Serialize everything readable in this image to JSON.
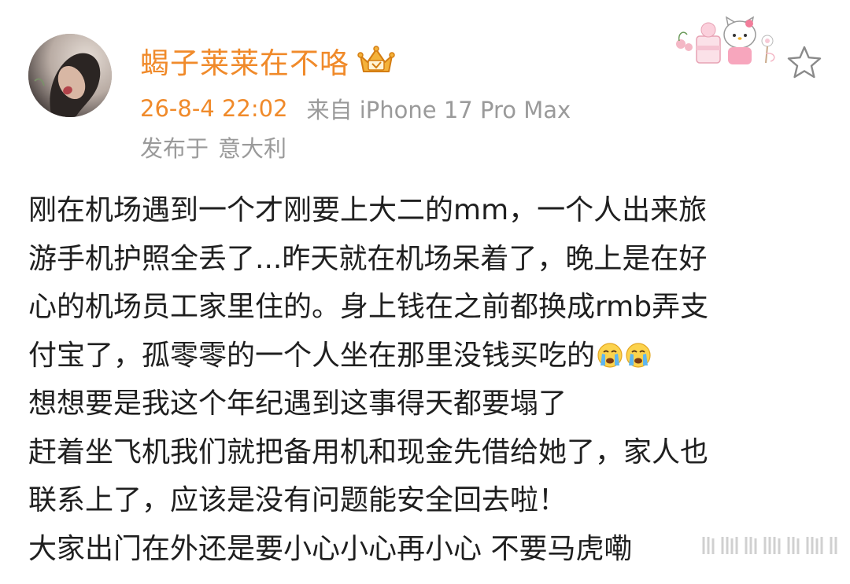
{
  "header": {
    "username": "蝎子莱莱在不咯",
    "timestamp": "26-8-4 22:02",
    "source": "来自 iPhone 17 Pro Max",
    "location_prefix": "发布于",
    "location": "意大利"
  },
  "icons": {
    "vip": "crown-vip-icon",
    "star": "star-icon",
    "decoration": "hello-kitty-sticker",
    "emoji": "crying-face-icon"
  },
  "post": {
    "lines": [
      "刚在机场遇到一个才刚要上大二的mm，一个人出来旅",
      "游手机护照全丢了...昨天就在机场呆着了，晚上是在好",
      "心的机场员工家里住的。身上钱在之前都换成rmb弄支",
      "付宝了，孤零零的一个人坐在那里没钱买吃的",
      "想想要是我这个年纪遇到这事得天都要塌了",
      "赶着坐飞机我们就把备用机和现金先借给她了，家人也",
      "联系上了，应该是没有问题能安全回去啦！",
      "大家出门在外还是要小心小心再小心 不要马虎嘞"
    ]
  },
  "colors": {
    "accent": "#f08a2a",
    "meta_gray": "#9a9a9a",
    "text": "#1f1f1f"
  }
}
